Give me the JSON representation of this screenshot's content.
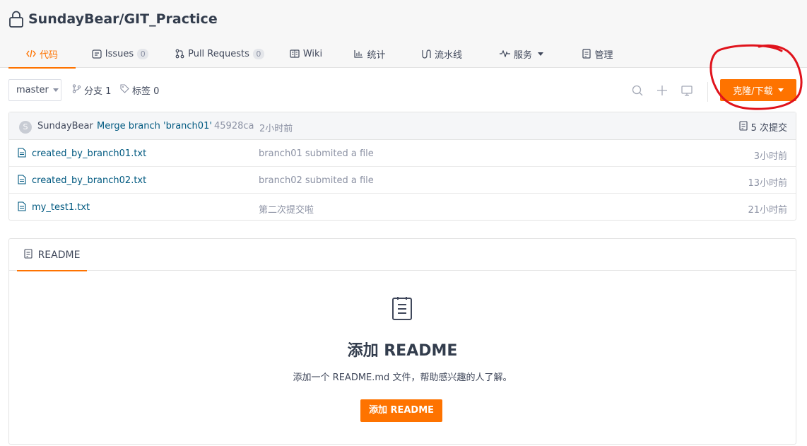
{
  "repo": {
    "title": "SundayBear/GIT_Practice"
  },
  "tabs": [
    {
      "label": "代码",
      "active": true,
      "icon": "code-icon"
    },
    {
      "label": "Issues",
      "count": "0",
      "icon": "issues-icon"
    },
    {
      "label": "Pull Requests",
      "count": "0",
      "icon": "pull-request-icon"
    },
    {
      "label": "Wiki",
      "icon": "wiki-icon"
    },
    {
      "label": "统计",
      "icon": "stats-icon"
    },
    {
      "label": "流水线",
      "icon": "pipeline-icon"
    },
    {
      "label": "服务",
      "icon": "service-icon",
      "dropdown": true
    },
    {
      "label": "管理",
      "icon": "manage-icon"
    }
  ],
  "toolbar": {
    "branch": "master",
    "branches_label": "分支 1",
    "tags_label": "标签 0",
    "clone_label": "克隆/下载"
  },
  "latest_commit": {
    "avatar_letter": "S",
    "author": "SundayBear",
    "message": "Merge branch 'branch01'",
    "sha": "45928ca",
    "time": "2小时前",
    "commit_count": "5 次提交"
  },
  "files": [
    {
      "name": "created_by_branch01.txt",
      "commit": "branch01 submited a file",
      "time": "3小时前"
    },
    {
      "name": "created_by_branch02.txt",
      "commit": "branch02 submited a file",
      "time": "13小时前"
    },
    {
      "name": "my_test1.txt",
      "commit": "第二次提交啦",
      "time": "21小时前"
    }
  ],
  "readme": {
    "tab_label": "README",
    "empty_title": "添加 README",
    "empty_desc": "添加一个 README.md 文件，帮助感兴趣的人了解。",
    "add_button": "添加 README"
  },
  "colors": {
    "accent": "#fe7300",
    "link": "#005980",
    "annotation": "#e0131c"
  }
}
